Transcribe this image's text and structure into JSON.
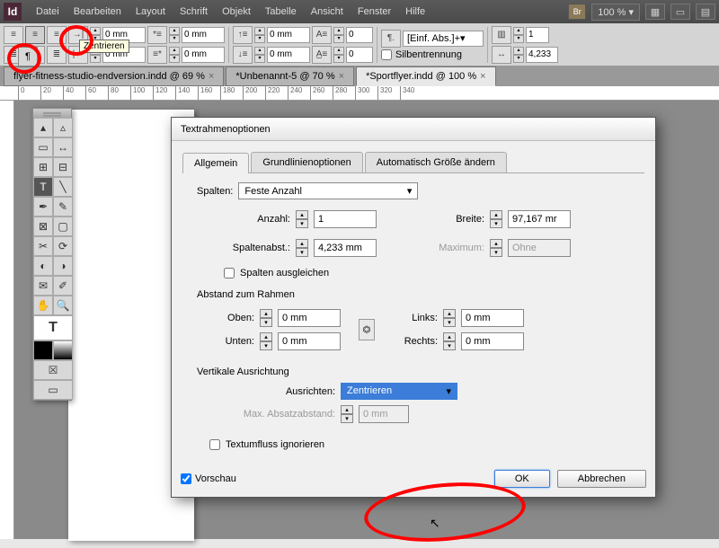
{
  "app_logo": "Id",
  "menu": [
    "Datei",
    "Bearbeiten",
    "Layout",
    "Schrift",
    "Objekt",
    "Tabelle",
    "Ansicht",
    "Fenster",
    "Hilfe"
  ],
  "menu_right": {
    "br": "Br",
    "zoom": "100 %"
  },
  "tooltip": "Zentrieren",
  "control_bar": {
    "indent_left": "0 mm",
    "indent_right": "0 mm",
    "first_line": "0 mm",
    "last_line": "0 mm",
    "space_before": "0 mm",
    "space_after": "0 mm",
    "para_style": "[Einf. Abs.]+",
    "hyphenation": "Silbentrennung",
    "cols": "1",
    "col_gap": "4,233"
  },
  "tabs": [
    {
      "label": "flyer-fitness-studio-endversion.indd @ 69 %",
      "active": false
    },
    {
      "label": "*Unbenannt-5 @ 70 %",
      "active": false
    },
    {
      "label": "*Sportflyer.indd @ 100 %",
      "active": true
    }
  ],
  "ruler": [
    "0",
    "20",
    "40",
    "60",
    "80",
    "100",
    "120",
    "140",
    "160",
    "180",
    "200",
    "220",
    "240",
    "260",
    "280",
    "300",
    "320",
    "340"
  ],
  "dialog": {
    "title": "Textrahmenoptionen",
    "tabs": [
      "Allgemein",
      "Grundlinienoptionen",
      "Automatisch Größe ändern"
    ],
    "spalten_label": "Spalten:",
    "spalten_value": "Feste Anzahl",
    "anzahl_label": "Anzahl:",
    "anzahl": "1",
    "breite_label": "Breite:",
    "breite": "97,167 mr",
    "abst_label": "Spaltenabst.:",
    "abst": "4,233 mm",
    "max_label": "Maximum:",
    "max": "Ohne",
    "balance": "Spalten ausgleichen",
    "frame_section": "Abstand zum Rahmen",
    "oben_l": "Oben:",
    "oben": "0 mm",
    "unten_l": "Unten:",
    "unten": "0 mm",
    "links_l": "Links:",
    "links": "0 mm",
    "rechts_l": "Rechts:",
    "rechts": "0 mm",
    "valign_section": "Vertikale Ausrichtung",
    "ausrichten_l": "Ausrichten:",
    "ausrichten": "Zentrieren",
    "maxabs_l": "Max. Absatzabstand:",
    "maxabs": "0 mm",
    "wrap": "Textumfluss ignorieren",
    "preview": "Vorschau",
    "ok": "OK",
    "cancel": "Abbrechen"
  }
}
